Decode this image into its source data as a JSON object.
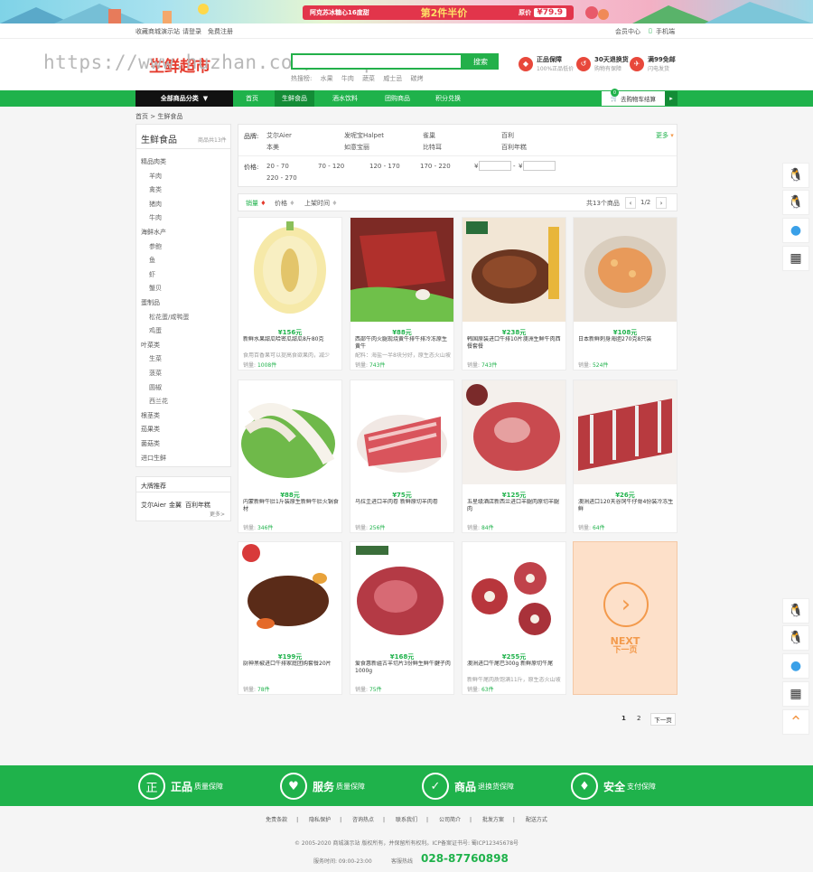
{
  "banner": {
    "text1": "阿克苏冰糖心16度甜",
    "text2": "第2件半价",
    "price_label": "原价",
    "price": "¥79.9"
  },
  "util": {
    "fav": "收藏商城演示站",
    "login": "请登录",
    "register": "免费注册",
    "member": "会员中心",
    "mobile": "手机端"
  },
  "watermark": "https://www.huzhan.com/ishop663",
  "logo": "生鲜超市",
  "search": {
    "placeholder": "",
    "button": "搜索",
    "hot_label": "热搜榜:",
    "hot": [
      "水果",
      "牛肉",
      "蔬菜",
      "威士忌",
      "碳烤"
    ]
  },
  "guarantees": [
    {
      "title": "正品保障",
      "sub": "100%正品低价"
    },
    {
      "title": "30天退换货",
      "sub": "购物有保障"
    },
    {
      "title": "满99免邮",
      "sub": "闪电发货"
    }
  ],
  "nav": {
    "category": "全部商品分类",
    "items": [
      "首页",
      "生鲜食品",
      "酒水饮料",
      "团购商品",
      "积分兑换"
    ],
    "cart": "去购物车结算",
    "cart_count": "0"
  },
  "breadcrumb": "首页 > 生鲜食品",
  "sidebar": {
    "title": "生鲜食品",
    "count": "商品共13件",
    "items": [
      {
        "label": "精品肉类",
        "sub": false
      },
      {
        "label": "羊肉",
        "sub": true
      },
      {
        "label": "禽类",
        "sub": true
      },
      {
        "label": "猪肉",
        "sub": true
      },
      {
        "label": "牛肉",
        "sub": true
      },
      {
        "label": "海鲜水产",
        "sub": false
      },
      {
        "label": "参鲍",
        "sub": true
      },
      {
        "label": "鱼",
        "sub": true
      },
      {
        "label": "虾",
        "sub": true
      },
      {
        "label": "蟹贝",
        "sub": true
      },
      {
        "label": "蛋制品",
        "sub": false
      },
      {
        "label": "松花蛋/咸鸭蛋",
        "sub": true
      },
      {
        "label": "鸡蛋",
        "sub": true
      },
      {
        "label": "叶菜类",
        "sub": false
      },
      {
        "label": "生菜",
        "sub": true
      },
      {
        "label": "菠菜",
        "sub": true
      },
      {
        "label": "圆椒",
        "sub": true
      },
      {
        "label": "西兰花",
        "sub": true
      },
      {
        "label": "根茎类",
        "sub": false
      },
      {
        "label": "茄果类",
        "sub": false
      },
      {
        "label": "菌菇类",
        "sub": false
      },
      {
        "label": "进口生鲜",
        "sub": false
      }
    ],
    "brand_title": "大牌推荐",
    "brands": [
      "艾尔Aier",
      "金翼",
      "百利年糕"
    ],
    "brand_more": "更多>"
  },
  "filter": {
    "brand_label": "品牌:",
    "brands": [
      "艾尔Aier",
      "发呢宝Halpet",
      "雀巢",
      "百利",
      "本美",
      "如意宝丽",
      "比特耳",
      "百利年糕"
    ],
    "more": "更多",
    "price_label": "价格:",
    "prices": [
      "20 - 70",
      "70 - 120",
      "120 - 170",
      "170 - 220",
      "220 - 270"
    ],
    "yen": "¥",
    "dash": "-"
  },
  "sort": {
    "items": [
      "销量",
      "价格",
      "上架时间"
    ],
    "total_label": "共13个商品",
    "page": "1/2",
    "prev": "‹",
    "next": "›"
  },
  "products": [
    {
      "price": "¥156元",
      "name": "新鲜水果甜瓜哈密瓜甜瓜8斤80克",
      "sub": "食用百香果可以提高食欲果肉，减少",
      "sales_label": "销量:",
      "sales": "1008件",
      "img": "melon"
    },
    {
      "price": "¥88元",
      "name": "西部牛肉火腿现烧黄牛排牛排冷冻原生黄牛",
      "sub": "配料：海盐一半8块分好，原生态火山坡",
      "sales_label": "销量:",
      "sales": "743件",
      "img": "beef"
    },
    {
      "price": "¥238元",
      "name": "韩国原装进口牛排10片澳洲生鲜牛肉西餐套餐",
      "sub": "",
      "sales_label": "销量:",
      "sales": "743件",
      "img": "steak"
    },
    {
      "price": "¥108元",
      "name": "日本新鲜刺身海胆270克8只装",
      "sub": "",
      "sales_label": "销量:",
      "sales": "524件",
      "img": "urchin"
    },
    {
      "price": "¥88元",
      "name": "内蒙新鲜牛肚1斤装原生新鲜牛肚火锅食材",
      "sub": "",
      "sales_label": "销量:",
      "sales": "346件",
      "img": "tripe"
    },
    {
      "price": "¥75元",
      "name": "乌拉圭进口羊肉卷 新鲜原切羊肉卷",
      "sub": "",
      "sales_label": "销量:",
      "sales": "256件",
      "img": "roll"
    },
    {
      "price": "¥125元",
      "name": "五星级酒店新西兰进口羊腿肉原切羊腿肉",
      "sub": "",
      "sales_label": "销量:",
      "sales": "84件",
      "img": "lamb"
    },
    {
      "price": "¥26元",
      "name": "澳洲进口120天谷饲牛仔骨4份装冷冻生鲜",
      "sub": "",
      "sales_label": "销量:",
      "sales": "64件",
      "img": "ribs"
    },
    {
      "price": "¥199元",
      "name": "厨神黑椒进口牛排家庭团购套餐20片",
      "sub": "",
      "sales_label": "销量:",
      "sales": "78件",
      "img": "grill"
    },
    {
      "price": "¥168元",
      "name": "爱食惠新疆古羊切片3份鲜生鲜牛腱子肉1000g",
      "sub": "",
      "sales_label": "销量:",
      "sales": "75件",
      "img": "shank"
    },
    {
      "price": "¥255元",
      "name": "澳洲进口牛尾巴300g 新鲜原切牛尾",
      "sub": "新鲜牛尾肉质饱满11斤，原生态火山坡",
      "sales_label": "销量:",
      "sales": "63件",
      "img": "oxtail"
    }
  ],
  "next_card": {
    "en": "NEXT",
    "cn": "下一页"
  },
  "pagination": {
    "p1": "1",
    "p2": "2",
    "next": "下一页"
  },
  "footer": {
    "items": [
      {
        "icon": "正",
        "big": "正品",
        "small": "质量保障"
      },
      {
        "icon": "♥",
        "big": "服务",
        "small": "质量保障"
      },
      {
        "icon": "✓",
        "big": "商品",
        "small": "退换货保障"
      },
      {
        "icon": "♦",
        "big": "安全",
        "small": "支付保障"
      }
    ],
    "links": [
      "免责条款",
      "隐私保护",
      "咨询热点",
      "联系我们",
      "公司简介",
      "批发方案",
      "配送方式"
    ],
    "copyright": "© 2005-2020 商城演示站 版权所有，并保留所有权利。ICP备案证书号: 蜀ICP12345678号",
    "hours": "服务时间: 09:00-23:00",
    "hotline_label": "客服热线",
    "hotline": "028-87760898"
  }
}
